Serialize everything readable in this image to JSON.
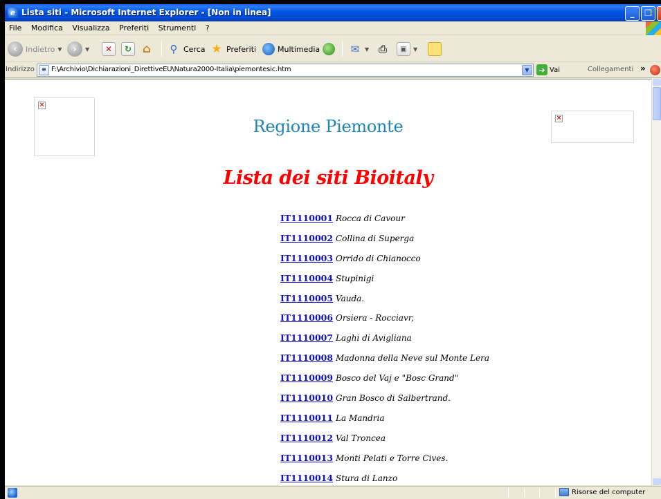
{
  "window": {
    "title": "Lista siti - Microsoft Internet Explorer - [Non in linea]",
    "buttons": {
      "minimize": "_",
      "maximize": "❐",
      "close": "✕"
    }
  },
  "menubar": {
    "items": [
      "File",
      "Modifica",
      "Visualizza",
      "Preferiti",
      "Strumenti",
      "?"
    ]
  },
  "toolbar": {
    "back_label": "Indietro",
    "search_label": "Cerca",
    "favorites_label": "Preferiti",
    "multimedia_label": "Multimedia"
  },
  "addressbar": {
    "label": "Indirizzo",
    "url": "F:\\Archivio\\Dichiarazioni_DirettiveEU\\Natura2000-Italia\\piemontesic.htm",
    "go_label": "Vai",
    "links_label": "Collegamenti"
  },
  "page": {
    "region_title": "Regione Piemonte",
    "list_title": "Lista dei siti Bioitaly",
    "sites": [
      {
        "code": "IT1110001",
        "name": "Rocca di Cavour"
      },
      {
        "code": "IT1110002",
        "name": "Collina di Superga"
      },
      {
        "code": "IT1110003",
        "name": "Orrido di Chianocco"
      },
      {
        "code": "IT1110004",
        "name": "Stupinigi"
      },
      {
        "code": "IT1110005",
        "name": "Vauda."
      },
      {
        "code": "IT1110006",
        "name": "Orsiera - Rocciavr,"
      },
      {
        "code": "IT1110007",
        "name": "Laghi di Avigliana"
      },
      {
        "code": "IT1110008",
        "name": "Madonna della Neve sul Monte Lera"
      },
      {
        "code": "IT1110009",
        "name": "Bosco del Vaj e \"Bosc Grand\""
      },
      {
        "code": "IT1110010",
        "name": "Gran Bosco di Salbertrand."
      },
      {
        "code": "IT1110011",
        "name": "La Mandria"
      },
      {
        "code": "IT1110012",
        "name": "Val Troncea"
      },
      {
        "code": "IT1110013",
        "name": "Monti Pelati e Torre Cives."
      },
      {
        "code": "IT1110014",
        "name": "Stura di Lanzo"
      }
    ]
  },
  "statusbar": {
    "zone_label": "Risorse del computer"
  },
  "colors": {
    "region_title": "#1f84b6",
    "list_title": "#ff0000",
    "link": "#1010c0"
  }
}
